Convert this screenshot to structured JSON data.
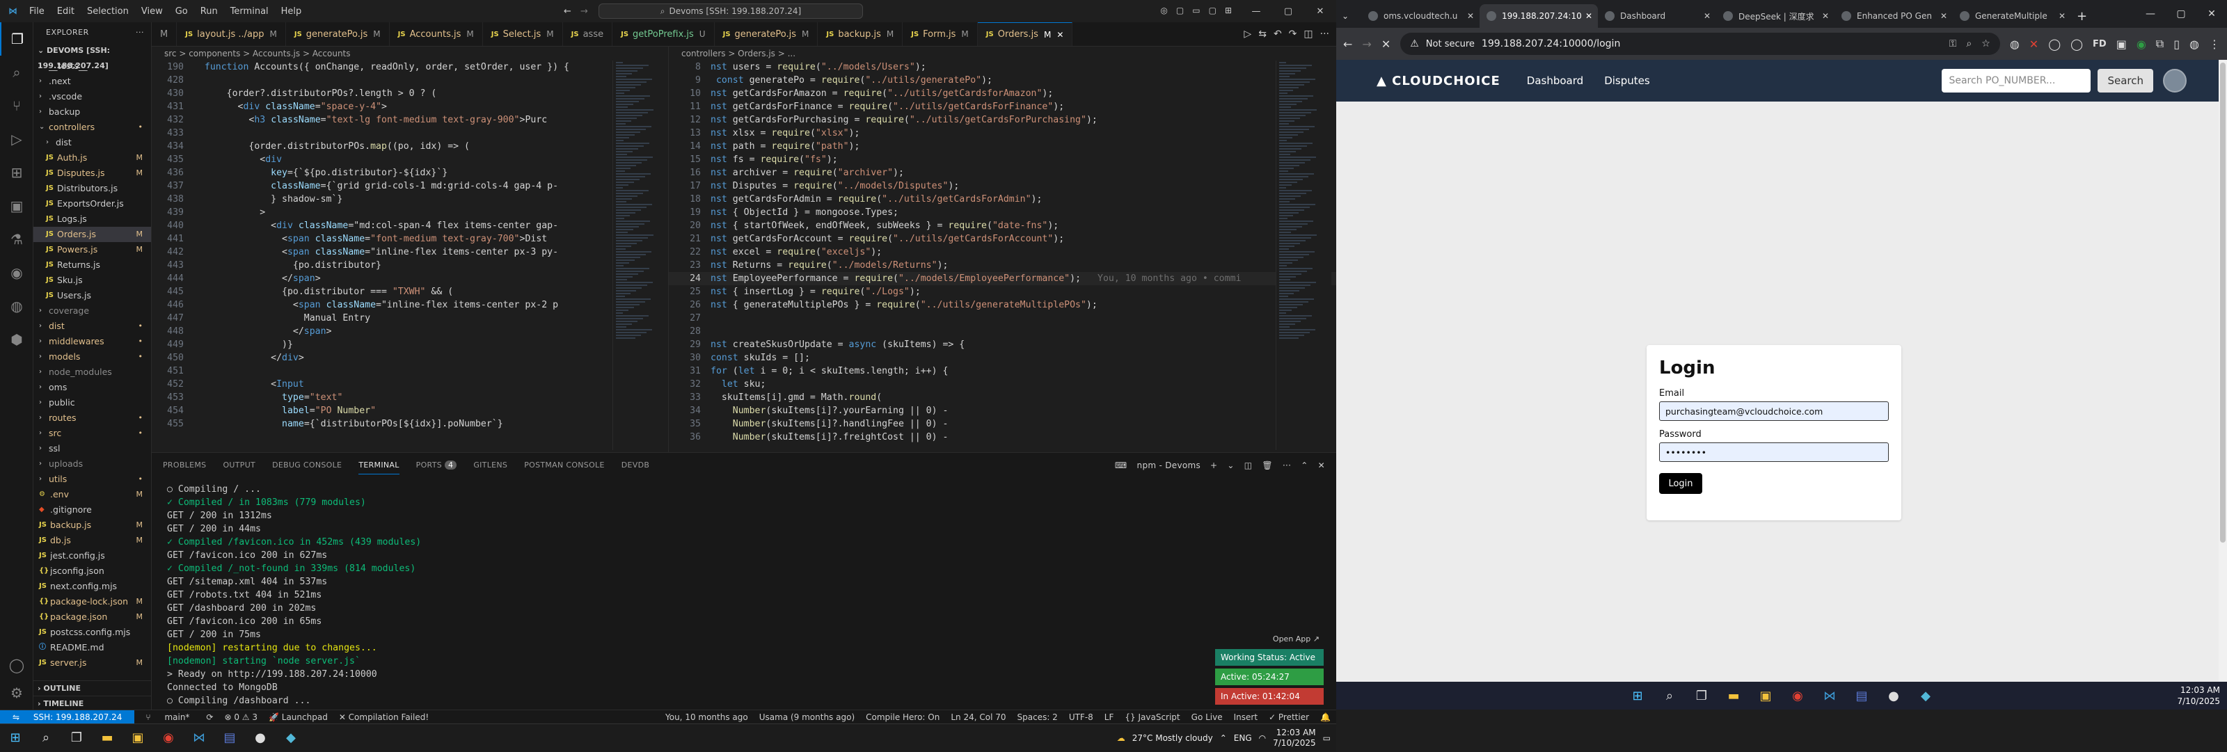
{
  "vscode": {
    "menu": [
      "File",
      "Edit",
      "Selection",
      "View",
      "Go",
      "Run",
      "Terminal",
      "Help"
    ],
    "command_center": "Devoms [SSH: 199.188.207.24]",
    "explorer_header": "EXPLORER",
    "root": "DEVOMS [SSH: 199.188.207.24]",
    "tree": [
      {
        "label": "__tests__",
        "type": "folder",
        "depth": 0,
        "badge": "",
        "color": "#ccc"
      },
      {
        "label": ".next",
        "type": "folder",
        "depth": 0,
        "badge": "",
        "color": "#ccc"
      },
      {
        "label": ".vscode",
        "type": "folder",
        "depth": 0,
        "badge": "",
        "color": "#ccc"
      },
      {
        "label": "backup",
        "type": "folder",
        "depth": 0,
        "badge": "",
        "color": "#ccc"
      },
      {
        "label": "controllers",
        "type": "folder-open",
        "depth": 0,
        "badge": "•",
        "color": "#e2c08d"
      },
      {
        "label": "dist",
        "type": "folder",
        "depth": 1,
        "badge": "",
        "color": "#ccc"
      },
      {
        "label": "Auth.js",
        "type": "js",
        "depth": 1,
        "badge": "M",
        "color": "#e2c08d"
      },
      {
        "label": "Disputes.js",
        "type": "js",
        "depth": 1,
        "badge": "M",
        "color": "#e2c08d"
      },
      {
        "label": "Distributors.js",
        "type": "js",
        "depth": 1,
        "badge": "",
        "color": "#ccc"
      },
      {
        "label": "ExportsOrder.js",
        "type": "js",
        "depth": 1,
        "badge": "",
        "color": "#ccc"
      },
      {
        "label": "Logs.js",
        "type": "js",
        "depth": 1,
        "badge": "",
        "color": "#ccc"
      },
      {
        "label": "Orders.js",
        "type": "js",
        "depth": 1,
        "badge": "M",
        "color": "#e2c08d",
        "sel": true
      },
      {
        "label": "Powers.js",
        "type": "js",
        "depth": 1,
        "badge": "M",
        "color": "#e2c08d"
      },
      {
        "label": "Returns.js",
        "type": "js",
        "depth": 1,
        "badge": "",
        "color": "#ccc"
      },
      {
        "label": "Sku.js",
        "type": "js",
        "depth": 1,
        "badge": "",
        "color": "#ccc"
      },
      {
        "label": "Users.js",
        "type": "js",
        "depth": 1,
        "badge": "",
        "color": "#ccc"
      },
      {
        "label": "coverage",
        "type": "folder",
        "depth": 0,
        "badge": "",
        "color": "#8c8c8c"
      },
      {
        "label": "dist",
        "type": "folder",
        "depth": 0,
        "badge": "•",
        "color": "#e2c08d"
      },
      {
        "label": "middlewares",
        "type": "folder",
        "depth": 0,
        "badge": "•",
        "color": "#e2c08d"
      },
      {
        "label": "models",
        "type": "folder",
        "depth": 0,
        "badge": "•",
        "color": "#e2c08d"
      },
      {
        "label": "node_modules",
        "type": "folder",
        "depth": 0,
        "badge": "",
        "color": "#8c8c8c"
      },
      {
        "label": "oms",
        "type": "folder",
        "depth": 0,
        "badge": "",
        "color": "#ccc"
      },
      {
        "label": "public",
        "type": "folder",
        "depth": 0,
        "badge": "",
        "color": "#ccc"
      },
      {
        "label": "routes",
        "type": "folder",
        "depth": 0,
        "badge": "•",
        "color": "#e2c08d"
      },
      {
        "label": "src",
        "type": "folder",
        "depth": 0,
        "badge": "•",
        "color": "#e2c08d"
      },
      {
        "label": "ssl",
        "type": "folder",
        "depth": 0,
        "badge": "",
        "color": "#ccc"
      },
      {
        "label": "uploads",
        "type": "folder",
        "depth": 0,
        "badge": "",
        "color": "#8c8c8c"
      },
      {
        "label": "utils",
        "type": "folder",
        "depth": 0,
        "badge": "•",
        "color": "#e2c08d"
      },
      {
        "label": ".env",
        "type": "env",
        "depth": 0,
        "badge": "M",
        "color": "#e2c08d"
      },
      {
        "label": ".gitignore",
        "type": "git",
        "depth": 0,
        "badge": "",
        "color": "#ccc"
      },
      {
        "label": "backup.js",
        "type": "js",
        "depth": 0,
        "badge": "M",
        "color": "#e2c08d"
      },
      {
        "label": "db.js",
        "type": "js",
        "depth": 0,
        "badge": "M",
        "color": "#e2c08d"
      },
      {
        "label": "jest.config.js",
        "type": "js",
        "depth": 0,
        "badge": "",
        "color": "#ccc"
      },
      {
        "label": "jsconfig.json",
        "type": "json",
        "depth": 0,
        "badge": "",
        "color": "#ccc"
      },
      {
        "label": "next.config.mjs",
        "type": "js",
        "depth": 0,
        "badge": "",
        "color": "#ccc"
      },
      {
        "label": "package-lock.json",
        "type": "json",
        "depth": 0,
        "badge": "M",
        "color": "#e2c08d"
      },
      {
        "label": "package.json",
        "type": "json",
        "depth": 0,
        "badge": "M",
        "color": "#e2c08d"
      },
      {
        "label": "postcss.config.mjs",
        "type": "js",
        "depth": 0,
        "badge": "",
        "color": "#ccc"
      },
      {
        "label": "README.md",
        "type": "md",
        "depth": 0,
        "badge": "",
        "color": "#ccc"
      },
      {
        "label": "server.js",
        "type": "js",
        "depth": 0,
        "badge": "M",
        "color": "#e2c08d"
      }
    ],
    "outline": "OUTLINE",
    "timeline": "TIMELINE",
    "tabs": [
      {
        "label": "M",
        "icon": "",
        "mod": ""
      },
      {
        "label": "layout.js ../app",
        "icon": "JS",
        "mod": "M"
      },
      {
        "label": "generatePo.js",
        "icon": "JS",
        "mod": "M"
      },
      {
        "label": "Accounts.js",
        "icon": "JS",
        "mod": "M"
      },
      {
        "label": "Select.js",
        "icon": "JS",
        "mod": "M"
      },
      {
        "label": "asse",
        "icon": "JS",
        "mod": ""
      },
      {
        "label": "getPoPrefix.js",
        "icon": "JS",
        "mod": "U"
      },
      {
        "label": "generatePo.js",
        "icon": "JS",
        "mod": "M"
      },
      {
        "label": "backup.js",
        "icon": "JS",
        "mod": "M"
      },
      {
        "label": "Form.js",
        "icon": "JS",
        "mod": "M"
      },
      {
        "label": "Orders.js",
        "icon": "JS",
        "mod": "M",
        "active": true
      }
    ],
    "left_breadcrumb": "src > components > Accounts.js > Accounts",
    "right_breadcrumb": "controllers > Orders.js > ...",
    "left_code": [
      {
        "n": "190",
        "t": "  function Accounts({ onChange, readOnly, order, setOrder, user }) {"
      },
      {
        "n": "428",
        "t": ""
      },
      {
        "n": "430",
        "t": "      {order?.distributorPOs?.length > 0 ? ("
      },
      {
        "n": "431",
        "t": "        <div className=\"space-y-4\">"
      },
      {
        "n": "432",
        "t": "          <h3 className=\"text-lg font-medium text-gray-900\">Purc"
      },
      {
        "n": "433",
        "t": ""
      },
      {
        "n": "434",
        "t": "          {order.distributorPOs.map((po, idx) => ("
      },
      {
        "n": "435",
        "t": "            <div"
      },
      {
        "n": "436",
        "t": "              key={`${po.distributor}-${idx}`}"
      },
      {
        "n": "437",
        "t": "              className={`grid grid-cols-1 md:grid-cols-4 gap-4 p-"
      },
      {
        "n": "438",
        "t": "              } shadow-sm`}"
      },
      {
        "n": "439",
        "t": "            >"
      },
      {
        "n": "440",
        "t": "              <div className=\"md:col-span-4 flex items-center gap-"
      },
      {
        "n": "441",
        "t": "                <span className=\"font-medium text-gray-700\">Dist"
      },
      {
        "n": "442",
        "t": "                <span className=\"inline-flex items-center px-3 py-"
      },
      {
        "n": "443",
        "t": "                  {po.distributor}"
      },
      {
        "n": "444",
        "t": "                </span>"
      },
      {
        "n": "445",
        "t": "                {po.distributor === \"TXWH\" && ("
      },
      {
        "n": "446",
        "t": "                  <span className=\"inline-flex items-center px-2 p"
      },
      {
        "n": "447",
        "t": "                    Manual Entry"
      },
      {
        "n": "448",
        "t": "                  </span>"
      },
      {
        "n": "449",
        "t": "                )}"
      },
      {
        "n": "450",
        "t": "              </div>"
      },
      {
        "n": "451",
        "t": ""
      },
      {
        "n": "452",
        "t": "              <Input"
      },
      {
        "n": "453",
        "t": "                type=\"text\""
      },
      {
        "n": "454",
        "t": "                label=\"PO Number\""
      },
      {
        "n": "455",
        "t": "                name={`distributorPOs[${idx}].poNumber`}"
      }
    ],
    "right_code": [
      {
        "n": "8",
        "t": "nst users = require(\"../models/Users\");"
      },
      {
        "n": "9",
        "t": " const generatePo = require(\"../utils/generatePo\");"
      },
      {
        "n": "10",
        "t": "nst getCardsForAmazon = require(\"../utils/getCardsforAmazon\");"
      },
      {
        "n": "11",
        "t": "nst getCardsForFinance = require(\"../utils/getCardsForFinance\");"
      },
      {
        "n": "12",
        "t": "nst getCardsForPurchasing = require(\"../utils/getCardsForPurchasing\");"
      },
      {
        "n": "13",
        "t": "nst xlsx = require(\"xlsx\");"
      },
      {
        "n": "14",
        "t": "nst path = require(\"path\");"
      },
      {
        "n": "15",
        "t": "nst fs = require(\"fs\");"
      },
      {
        "n": "16",
        "t": "nst archiver = require(\"archiver\");"
      },
      {
        "n": "17",
        "t": "nst Disputes = require(\"../models/Disputes\");"
      },
      {
        "n": "18",
        "t": "nst getCardsForAdmin = require(\"../utils/getCardsForAdmin\");"
      },
      {
        "n": "19",
        "t": "nst { ObjectId } = mongoose.Types;"
      },
      {
        "n": "20",
        "t": "nst { startOfWeek, endOfWeek, subWeeks } = require(\"date-fns\");"
      },
      {
        "n": "21",
        "t": "nst getCardsForAccount = require(\"../utils/getCardsForAccount\");"
      },
      {
        "n": "22",
        "t": "nst excel = require(\"exceljs\");"
      },
      {
        "n": "23",
        "t": "nst Returns = require(\"../models/Returns\");"
      },
      {
        "n": "24",
        "t": "nst EmployeePerformance = require(\"../models/EmployeePerformance\");",
        "blame": "You, 10 months ago • commi",
        "cur": true
      },
      {
        "n": "25",
        "t": "nst { insertLog } = require(\"./Logs\");"
      },
      {
        "n": "26",
        "t": "nst { generateMultiplePOs } = require(\"../utils/generateMultiplePOs\");"
      },
      {
        "n": "27",
        "t": ""
      },
      {
        "n": "28",
        "t": ""
      },
      {
        "n": "29",
        "t": "nst createSkusOrUpdate = async (skuItems) => {"
      },
      {
        "n": "30",
        "t": "const skuIds = [];"
      },
      {
        "n": "31",
        "t": "for (let i = 0; i < skuItems.length; i++) {"
      },
      {
        "n": "32",
        "t": "  let sku;"
      },
      {
        "n": "33",
        "t": "  skuItems[i].gmd = Math.round("
      },
      {
        "n": "34",
        "t": "    Number(skuItems[i]?.yourEarning || 0) -"
      },
      {
        "n": "35",
        "t": "    Number(skuItems[i]?.handlingFee || 0) -"
      },
      {
        "n": "36",
        "t": "    Number(skuItems[i]?.freightCost || 0) -"
      }
    ],
    "panel_tabs": [
      "PROBLEMS",
      "OUTPUT",
      "DEBUG CONSOLE",
      "TERMINAL",
      "PORTS",
      "GITLENS",
      "POSTMAN CONSOLE",
      "DEVDB"
    ],
    "ports_count": "4",
    "terminal_name": "npm - Devoms",
    "terminal": [
      {
        "t": "○ Compiling / ...",
        "c": ""
      },
      {
        "t": "✓ Compiled / in 1083ms (779 modules)",
        "c": "g1"
      },
      {
        "t": "GET / 200 in 1312ms",
        "c": "get"
      },
      {
        "t": "GET / 200 in 44ms",
        "c": "get"
      },
      {
        "t": "✓ Compiled /favicon.ico in 452ms (439 modules)",
        "c": "g1"
      },
      {
        "t": "GET /favicon.ico 200 in 627ms",
        "c": "get"
      },
      {
        "t": "✓ Compiled /_not-found in 339ms (814 modules)",
        "c": "g1"
      },
      {
        "t": "GET /sitemap.xml 404 in 537ms",
        "c": "get"
      },
      {
        "t": "GET /robots.txt 404 in 521ms",
        "c": "get"
      },
      {
        "t": "GET /dashboard 200 in 202ms",
        "c": "get"
      },
      {
        "t": "GET /favicon.ico 200 in 65ms",
        "c": "get"
      },
      {
        "t": "GET / 200 in 75ms",
        "c": "get"
      },
      {
        "t": "[nodemon] restarting due to changes...",
        "c": "y"
      },
      {
        "t": "[nodemon] starting `node server.js`",
        "c": "g"
      },
      {
        "t": "> Ready on http://199.188.207.24:10000",
        "c": ""
      },
      {
        "t": "Connected to MongoDB",
        "c": ""
      },
      {
        "t": "○ Compiling /dashboard ...",
        "c": ""
      },
      {
        "t": "▯",
        "c": ""
      }
    ],
    "toasts": {
      "open_app": "Open App ↗",
      "working": "Working Status: Active",
      "active": "Active: 05:24:27",
      "inactive": "In Active: 01:42:04"
    },
    "status": {
      "remote": "SSH: 199.188.207.24",
      "branch": "main*",
      "sync": "⟳",
      "errors": "⊗ 0 ⚠ 3",
      "compile": "✕ Compilation Failed!",
      "blame": "You, 10 months ago",
      "author": "Usama (9 months ago)",
      "hero": "Compile Hero: On",
      "pos": "Ln 24, Col 70",
      "spaces": "Spaces: 2",
      "enc": "UTF-8",
      "eol": "LF",
      "lang": "{} JavaScript",
      "golive": "Go Live",
      "ins": "Insert",
      "prettier": "✓ Prettier"
    },
    "taskbar1": {
      "weather": "27°C  Mostly cloudy",
      "time": "12:03 AM",
      "date": "7/10/2025",
      "lang": "ENG"
    }
  },
  "chrome": {
    "tabs": [
      {
        "label": "oms.vcloudtech.u",
        "active": false
      },
      {
        "label": "199.188.207.24:10",
        "active": true
      },
      {
        "label": "Dashboard",
        "active": false
      },
      {
        "label": "DeepSeek | 深度求",
        "active": false
      },
      {
        "label": "Enhanced PO Gen",
        "active": false
      },
      {
        "label": "GenerateMultiple",
        "active": false
      }
    ],
    "not_secure": "Not secure",
    "url": "199.188.207.24:10000/login",
    "site": {
      "logo": "CLOUDCHOICE",
      "nav": [
        "Dashboard",
        "Disputes"
      ],
      "search_placeholder": "Search PO_NUMBER...",
      "search_btn": "Search"
    },
    "login": {
      "title": "Login",
      "email_label": "Email",
      "email_value": "purchasingteam@vcloudchoice.com",
      "password_label": "Password",
      "password_value": "••••••••",
      "button": "Login"
    },
    "taskbar2": {
      "time": "12:03 AM",
      "date": "7/10/2025"
    }
  }
}
